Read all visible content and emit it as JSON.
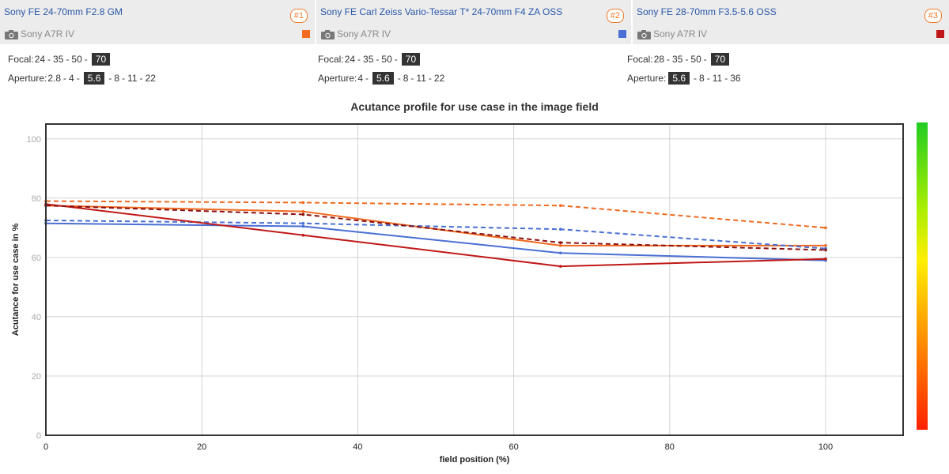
{
  "lenses": [
    {
      "name": "Sony FE 24-70mm F2.8 GM",
      "rank": "#1",
      "camera": "Sony A7R IV",
      "color": "#f06a20",
      "focal_label": "Focal:",
      "focal_values": [
        "24",
        "35",
        "50",
        "70"
      ],
      "focal_selected": "70",
      "aperture_label": "Aperture:",
      "aperture_values": [
        "2.8",
        "4",
        "5.6",
        "8",
        "11",
        "22"
      ],
      "aperture_selected": "5.6"
    },
    {
      "name": "Sony FE Carl Zeiss Vario-Tessar T* 24-70mm F4 ZA OSS",
      "rank": "#2",
      "camera": "Sony A7R IV",
      "color": "#4a6fd4",
      "focal_label": "Focal:",
      "focal_values": [
        "24",
        "35",
        "50",
        "70"
      ],
      "focal_selected": "70",
      "aperture_label": "Aperture:",
      "aperture_values": [
        "4",
        "5.6",
        "8",
        "11",
        "22"
      ],
      "aperture_selected": "5.6"
    },
    {
      "name": "Sony FE 28-70mm F3.5-5.6 OSS",
      "rank": "#3",
      "camera": "Sony A7R IV",
      "color": "#c01818",
      "focal_label": "Focal:",
      "focal_values": [
        "28",
        "35",
        "50",
        "70"
      ],
      "focal_selected": "70",
      "aperture_label": "Aperture:",
      "aperture_values": [
        "5.6",
        "8",
        "11",
        "36"
      ],
      "aperture_selected": "5.6"
    }
  ],
  "chart_data": {
    "type": "line",
    "title": "Acutance profile for use case in the image field",
    "xlabel": "field position (%)",
    "ylabel": "Acutance for use case in %",
    "xlim": [
      0,
      100
    ],
    "ylim": [
      0,
      105
    ],
    "xticks": [
      0,
      20,
      40,
      60,
      80,
      100
    ],
    "yticks": [
      0,
      20,
      40,
      60,
      80,
      100
    ],
    "grid": true,
    "series": [
      {
        "color": "#f06a20",
        "style": "solid",
        "x": [
          0,
          33,
          66,
          100
        ],
        "y": [
          77.5,
          75.5,
          64,
          64
        ]
      },
      {
        "color": "#f06a20",
        "style": "dashed",
        "x": [
          0,
          33,
          66,
          100
        ],
        "y": [
          79,
          78.5,
          77.5,
          70
        ]
      },
      {
        "color": "#4a6fd4",
        "style": "solid",
        "x": [
          0,
          33,
          66,
          100
        ],
        "y": [
          71.5,
          70.5,
          61.5,
          59
        ]
      },
      {
        "color": "#4a6fd4",
        "style": "dashed",
        "x": [
          0,
          33,
          66,
          100
        ],
        "y": [
          72.5,
          71.5,
          69.5,
          63
        ]
      },
      {
        "color": "#c01818",
        "style": "solid",
        "x": [
          0,
          33,
          66,
          100
        ],
        "y": [
          78,
          67.5,
          57,
          59.5
        ]
      },
      {
        "color": "#8b1010",
        "style": "dashed",
        "x": [
          0,
          33,
          66,
          100
        ],
        "y": [
          77.5,
          74.5,
          65,
          62.5
        ]
      }
    ],
    "colorbar": {
      "top_color": "#22cc22",
      "bottom_color": "#ff2200"
    }
  }
}
